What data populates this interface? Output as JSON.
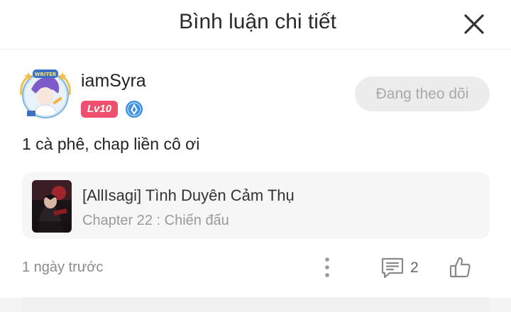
{
  "header": {
    "title": "Bình luận chi tiết",
    "close_icon": "close-icon"
  },
  "comment": {
    "username": "iamSyra",
    "level": "Lv10",
    "avatar_frame_text": "WRITER",
    "verify_icon": "verified-badge-icon",
    "follow_label": "Đang theo dõi",
    "text": "1 cà phê, chap liền cô ơi",
    "story": {
      "title": "[AllIsagi] Tình Duyên Cảm Thụ",
      "chapter": "Chapter 22 : Chiến đấu"
    },
    "time": "1 ngày trước",
    "reply_count": "2",
    "icons": {
      "more": "more-vertical-icon",
      "reply": "comment-icon",
      "like": "thumbs-up-icon"
    }
  },
  "colors": {
    "level_badge": "#f0506e",
    "verify_badge": "#3d8fe0",
    "follow_bg": "#ececec",
    "follow_text": "#a9a9a9",
    "card_bg": "#f6f6f6"
  }
}
